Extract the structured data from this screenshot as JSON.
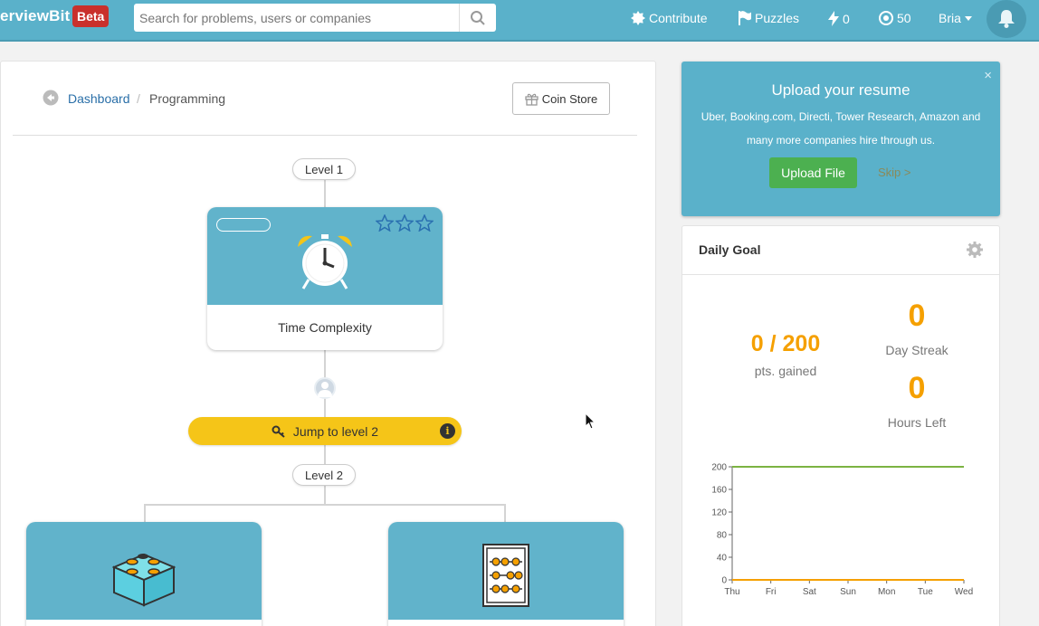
{
  "navbar": {
    "brand": "erviewBit",
    "beta": "Beta",
    "search_placeholder": "Search for problems, users or companies",
    "contribute": "Contribute",
    "puzzles": "Puzzles",
    "streak_count": "0",
    "coins_count": "50",
    "user": "Bria"
  },
  "breadcrumb": {
    "dashboard": "Dashboard",
    "separator": "/",
    "current": "Programming"
  },
  "coin_store": "Coin Store",
  "levels": {
    "level1": "Level 1",
    "level2": "Level 2"
  },
  "topics": {
    "time_complexity": "Time Complexity"
  },
  "jump_button": "Jump to level 2",
  "resume": {
    "title": "Upload your resume",
    "text": "Uber, Booking.com, Directi, Tower Research, Amazon and many more companies hire through us.",
    "upload": "Upload File",
    "skip": "Skip >",
    "close": "×"
  },
  "daily_goal": {
    "title": "Daily Goal",
    "points": "0 / 200",
    "points_label": "pts. gained",
    "day_streak": "0",
    "day_streak_label": "Day Streak",
    "hours_left": "0",
    "hours_left_label": "Hours Left"
  },
  "colors": {
    "primary": "#5ab1ca",
    "accent": "#f5a000",
    "jump": "#f5c518",
    "upload": "#4cb050",
    "beta": "#c9302c"
  },
  "chart_data": {
    "type": "line",
    "categories": [
      "Thu",
      "Fri",
      "Sat",
      "Sun",
      "Mon",
      "Tue",
      "Wed"
    ],
    "yticks": [
      0,
      40,
      80,
      120,
      160,
      200
    ],
    "ylim": [
      0,
      200
    ],
    "series": [
      {
        "values": [
          200,
          200,
          200,
          200,
          200,
          200,
          200
        ],
        "color": "#7cb342"
      },
      {
        "values": [
          0,
          0,
          0,
          0,
          0,
          0,
          0
        ],
        "color": "#f5a000"
      }
    ]
  }
}
